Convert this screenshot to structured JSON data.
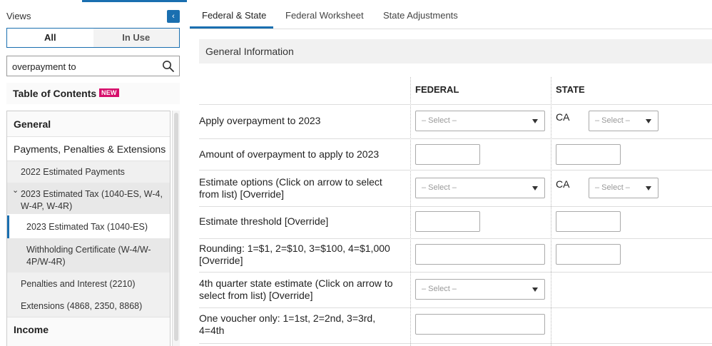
{
  "sidebar": {
    "views_label": "Views",
    "collapse_glyph": "‹",
    "toggle_all": "All",
    "toggle_in_use": "In Use",
    "search_value": "overpayment to",
    "toc_title": "Table of Contents",
    "new_badge": "NEW",
    "tree": {
      "general": "General",
      "payments": "Payments, Penalties & Extensions",
      "est_2022": "2022 Estimated Payments",
      "est_2023_chevron": "⌄",
      "est_2023": "2023 Estimated Tax (1040-ES, W-4, W-4P, W-4R)",
      "est_2023_es": "2023 Estimated Tax (1040-ES)",
      "withholding": "Withholding Certificate (W-4/W-4P/W-4R)",
      "penalties": "Penalties and Interest (2210)",
      "extensions": "Extensions (4868, 2350, 8868)",
      "income": "Income"
    }
  },
  "tabs": {
    "federal_state": "Federal & State",
    "federal_worksheet": "Federal Worksheet",
    "state_adjustments": "State Adjustments"
  },
  "section_title": "General Information",
  "columns": {
    "federal": "FEDERAL",
    "state": "STATE"
  },
  "select_placeholder": "– Select –",
  "rows": {
    "r1": {
      "label": "Apply overpayment to 2023",
      "state_code": "CA"
    },
    "r2": {
      "label": "Amount of overpayment to apply to 2023"
    },
    "r3": {
      "label": "Estimate options (Click on arrow to select from list) [Override]",
      "state_code": "CA"
    },
    "r4": {
      "label": "Estimate threshold [Override]"
    },
    "r5": {
      "label": "Rounding: 1=$1, 2=$10, 3=$100, 4=$1,000 [Override]"
    },
    "r6": {
      "label": "4th quarter state estimate (Click on arrow to select from list) [Override]"
    },
    "r7": {
      "label": "One voucher only: 1=1st, 2=2nd, 3=3rd, 4=4th"
    }
  },
  "colors": {
    "accent": "#1a6fb0",
    "badge": "#d6106c",
    "selected_bg": "#e8e8e8"
  }
}
